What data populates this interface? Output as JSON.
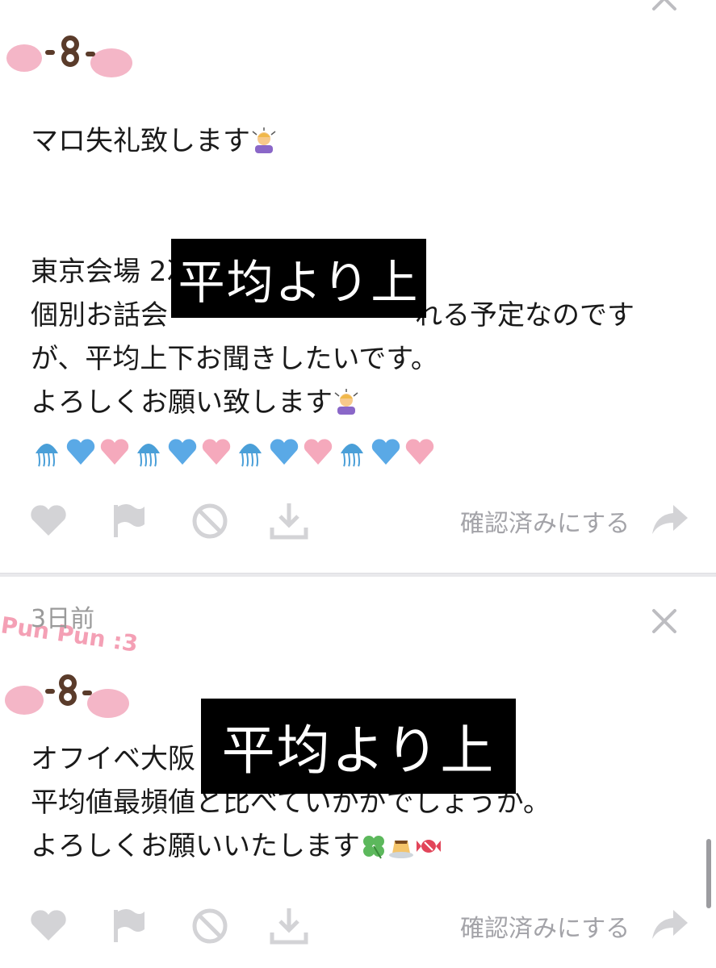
{
  "card1": {
    "message_line1": "マロ失礼致します",
    "message_rest": "東京会場 2次\n個別お話会　　　　　　　　　れる予定なのです\nが、平均上下お聞きしたいです。\nよろしくお願い致します",
    "redaction_label": "平均より上",
    "actions": {
      "confirm_label": "確認済みにする"
    }
  },
  "card2": {
    "timestamp": "3日前",
    "message_line1": "オフイベ大阪",
    "message_line2": "平均値最頻値と比べていかがでしょうか。",
    "message_line3": "よろしくお願いいたします",
    "redaction_label": "平均より上",
    "actions": {
      "confirm_label": "確認済みにする"
    }
  },
  "header_art_text": "Pun Pun :3",
  "icons": [
    "heart-icon",
    "flag-icon",
    "block-icon",
    "download-icon",
    "share-icon",
    "close-icon"
  ],
  "colors": {
    "action_icon": "#d3d3d6",
    "pink_cheek": "#f4b6c7",
    "blue_heart": "#5aa9e6",
    "pink_heart": "#f5a9bc"
  }
}
